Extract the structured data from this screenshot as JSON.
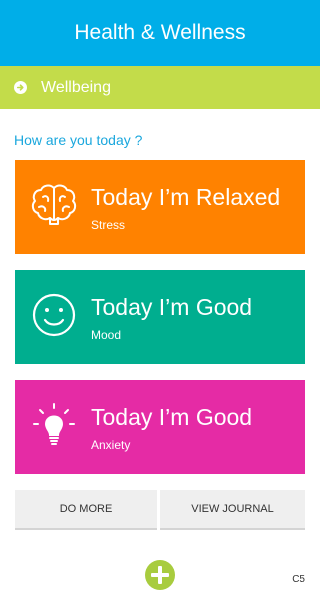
{
  "header": {
    "title": "Health & Wellness"
  },
  "section": {
    "label": "Wellbeing",
    "icon": "arrow-right-circle-icon"
  },
  "question": "How are you today ?",
  "cards": [
    {
      "title": "Today I’m Relaxed",
      "subtitle": "Stress",
      "color": "#ff8200",
      "icon": "brain-icon"
    },
    {
      "title": "Today I’m Good",
      "subtitle": "Mood",
      "color": "#00ae8f",
      "icon": "smiley-face-icon"
    },
    {
      "title": "Today I’m Good",
      "subtitle": "Anxiety",
      "color": "#e52ba5",
      "icon": "lightbulb-icon"
    }
  ],
  "actions": {
    "do_more": "DO MORE",
    "view_journal": "VIEW JOURNAL"
  },
  "footer": {
    "add_icon": "plus-circle-icon",
    "version": "C5"
  },
  "colors": {
    "header": "#00aee8",
    "section": "#c3dc4a",
    "accent_text": "#1aa7dd",
    "add_button": "#a8cc3e"
  }
}
